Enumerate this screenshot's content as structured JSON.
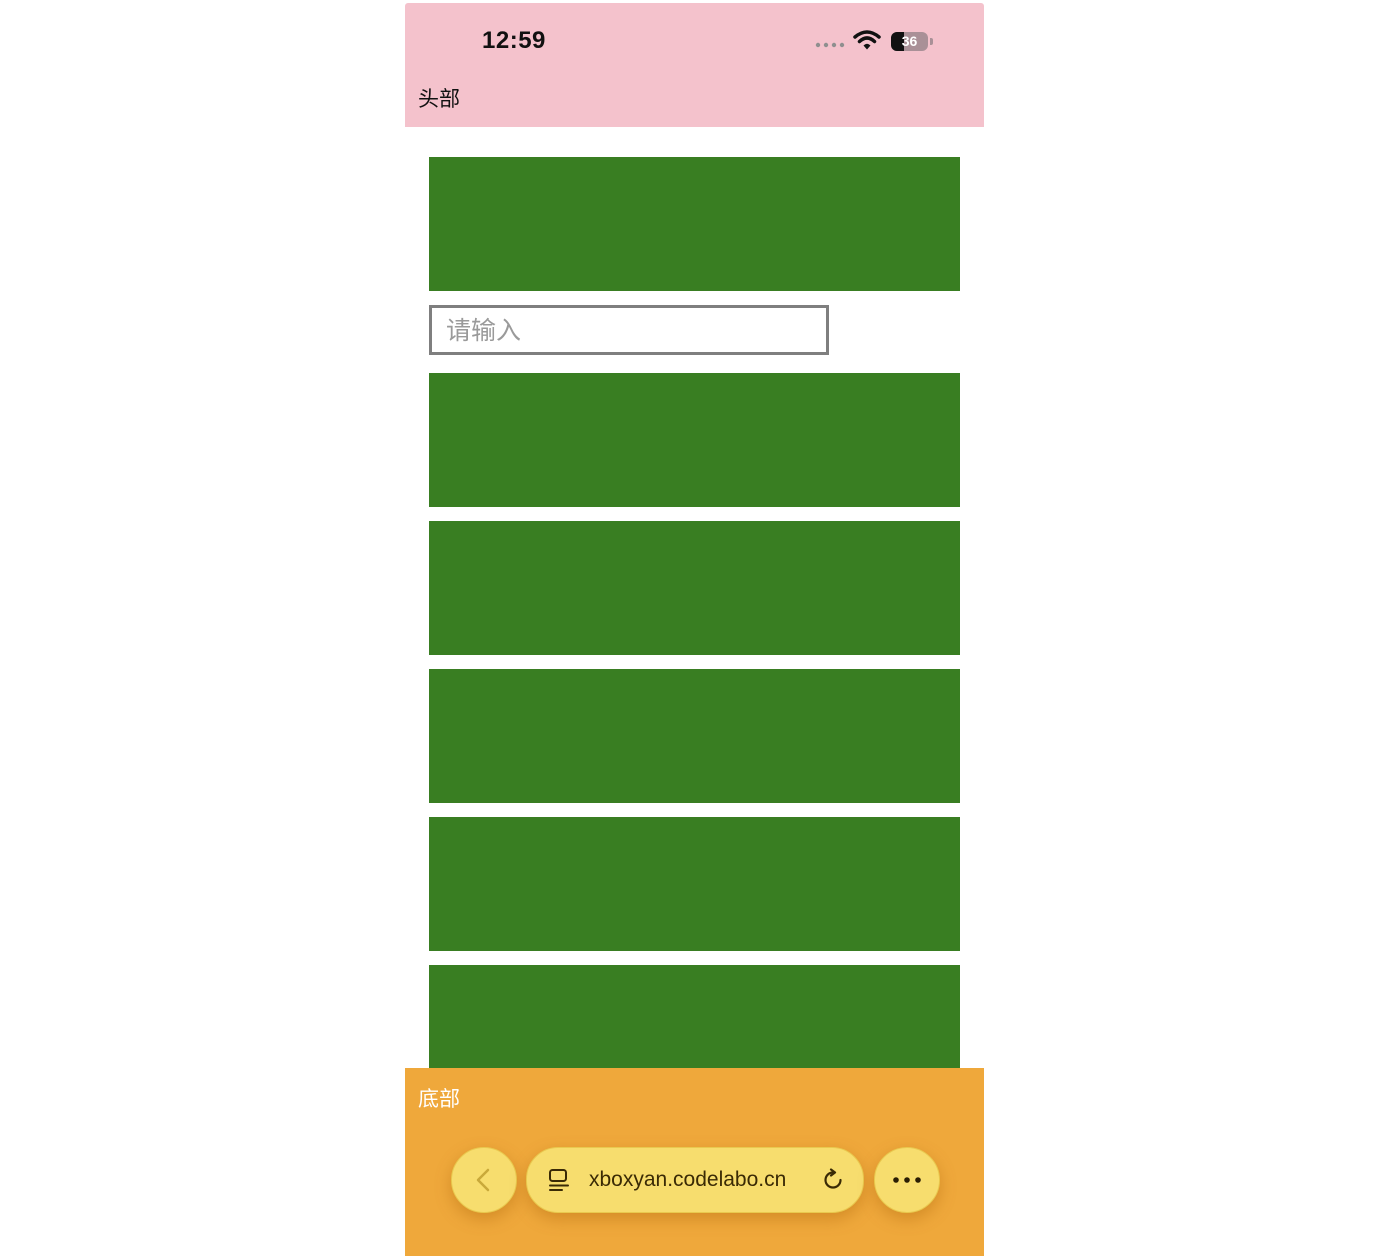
{
  "status_bar": {
    "time": "12:59",
    "battery": "36",
    "icons": [
      "signal-icon",
      "wifi-icon",
      "battery-icon"
    ]
  },
  "header": {
    "title": "头部",
    "color": "#f4c2cc"
  },
  "content": {
    "block_color": "#397e22",
    "input": {
      "placeholder": "请输入",
      "value": ""
    }
  },
  "footer": {
    "title": "底部",
    "color": "#efa83b",
    "browser_bar": {
      "url": "xboxyan.codelabo.cn",
      "buttons": [
        "back-icon",
        "tabs-icon",
        "reload-icon",
        "more-icon"
      ]
    }
  }
}
